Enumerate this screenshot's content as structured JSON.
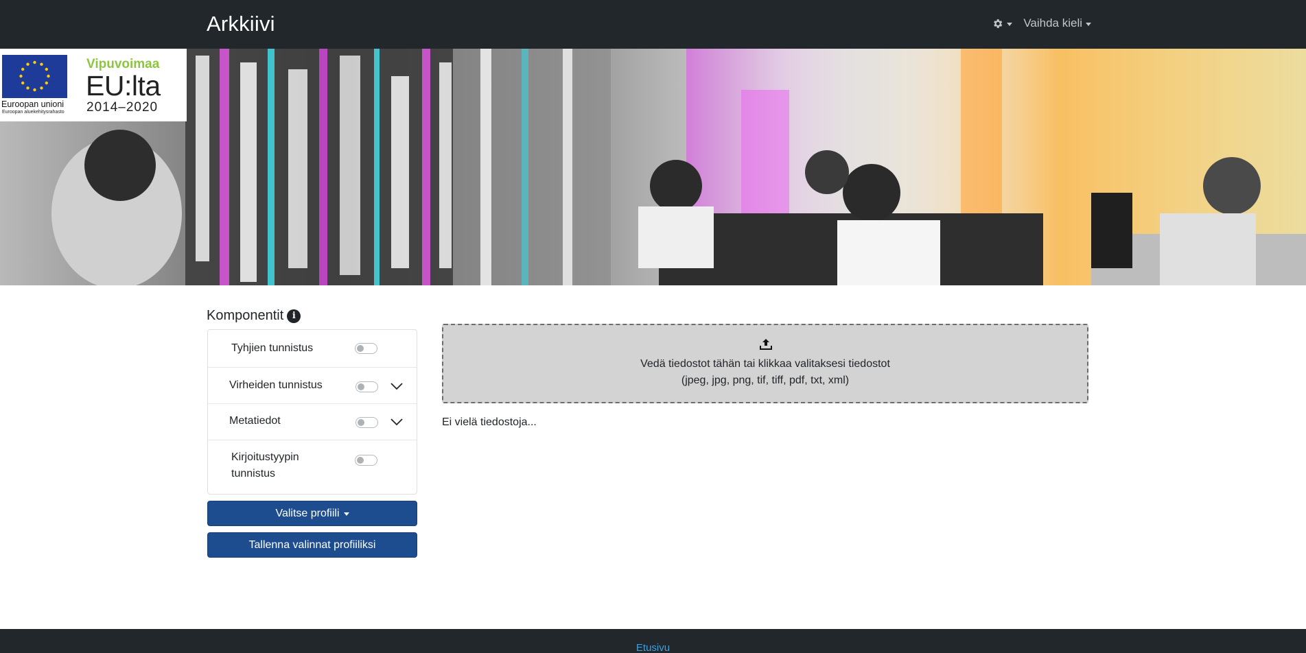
{
  "navbar": {
    "brand": "Arkkiivi",
    "settings_icon": "gear-icon",
    "language_label": "Vaihda kieli"
  },
  "banner": {
    "eu_label": "Euroopan unioni",
    "eu_sub": "Euroopan aluekehitysrahasto",
    "vip_line1": "Vipuvoimaa",
    "vip_line2": "EU:lta",
    "vip_line3": "2014–2020",
    "colors": {
      "eu_blue": "#1f3b9a",
      "eu_star": "#ffcc00",
      "vip_green": "#8cc63f"
    }
  },
  "components": {
    "title": "Komponentit",
    "info_icon": "info-icon",
    "items": [
      {
        "label": "Tyhjien tunnistus",
        "enabled": false,
        "expandable": false
      },
      {
        "label": "Virheiden tunnistus",
        "enabled": false,
        "expandable": true
      },
      {
        "label": "Metatiedot",
        "enabled": false,
        "expandable": true
      },
      {
        "label": "Kirjoitustyypin tunnistus",
        "enabled": false,
        "expandable": false
      }
    ]
  },
  "buttons": {
    "select_profile": "Valitse profiili",
    "save_profile": "Tallenna valinnat profiiliksi"
  },
  "dropzone": {
    "icon": "upload-icon",
    "line1": "Vedä tiedostot tähän tai klikkaa valitaksesi tiedostot",
    "line2": "(jpeg, jpg, png, tif, tiff, pdf, txt, xml)"
  },
  "files": {
    "empty_text": "Ei vielä tiedostoja..."
  },
  "footer": {
    "link": "Etusivu"
  },
  "colors": {
    "navbar_bg": "#22272c",
    "primary_button": "#1e4d8f",
    "footer_link": "#3b9fe0"
  }
}
